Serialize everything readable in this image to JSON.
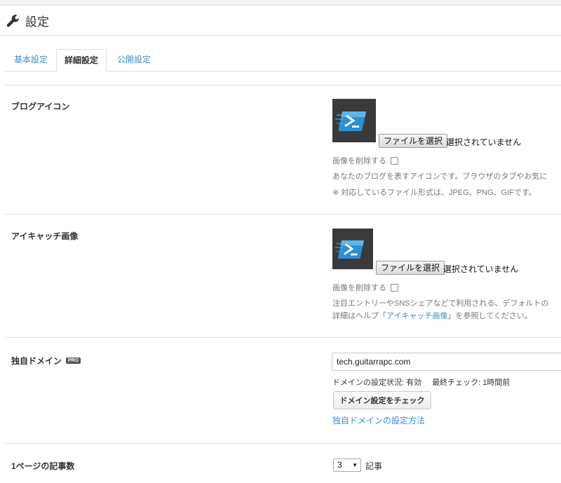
{
  "header": {
    "title": "設定",
    "icon": "wrench-icon"
  },
  "tabs": [
    {
      "label": "基本設定",
      "active": false
    },
    {
      "label": "詳細設定",
      "active": true
    },
    {
      "label": "公開設定",
      "active": false
    }
  ],
  "blog_icon": {
    "label": "ブログアイコン",
    "file_button": "ファイルを選択",
    "file_status": "選択されていません",
    "delete_label": "画像を削除する",
    "delete_checked": false,
    "help1": "あなたのブログを表すアイコンです。ブラウザのタブやお気に",
    "help2": "※ 対応しているファイル形式は、JPEG、PNG、GIFです。"
  },
  "eyecatch": {
    "label": "アイキャッチ画像",
    "file_button": "ファイルを選択",
    "file_status": "選択されていません",
    "delete_label": "画像を削除する",
    "delete_checked": false,
    "help1": "注目エントリーやSNSシェアなどで利用される、デフォルトの",
    "help2_prefix": "詳細はヘルプ「",
    "help2_link": "アイキャッチ画像",
    "help2_suffix": "」を参照してください。"
  },
  "domain": {
    "label": "独自ドメイン",
    "badge": "PRO",
    "value": "tech.guitarrapc.com",
    "status_label": "ドメインの設定状況:",
    "status_value": "有効",
    "last_check_label": "最終チェック:",
    "last_check_value": "1時間前",
    "check_button": "ドメイン設定をチェック",
    "help_link": "独自ドメインの設定方法"
  },
  "per_page": {
    "label": "1ページの記事数",
    "selected": "3",
    "unit": "記事"
  },
  "colors": {
    "link": "#3a8fc9",
    "icon_bg": "#3a3a3a",
    "icon_blue": "#2a8fd6"
  }
}
